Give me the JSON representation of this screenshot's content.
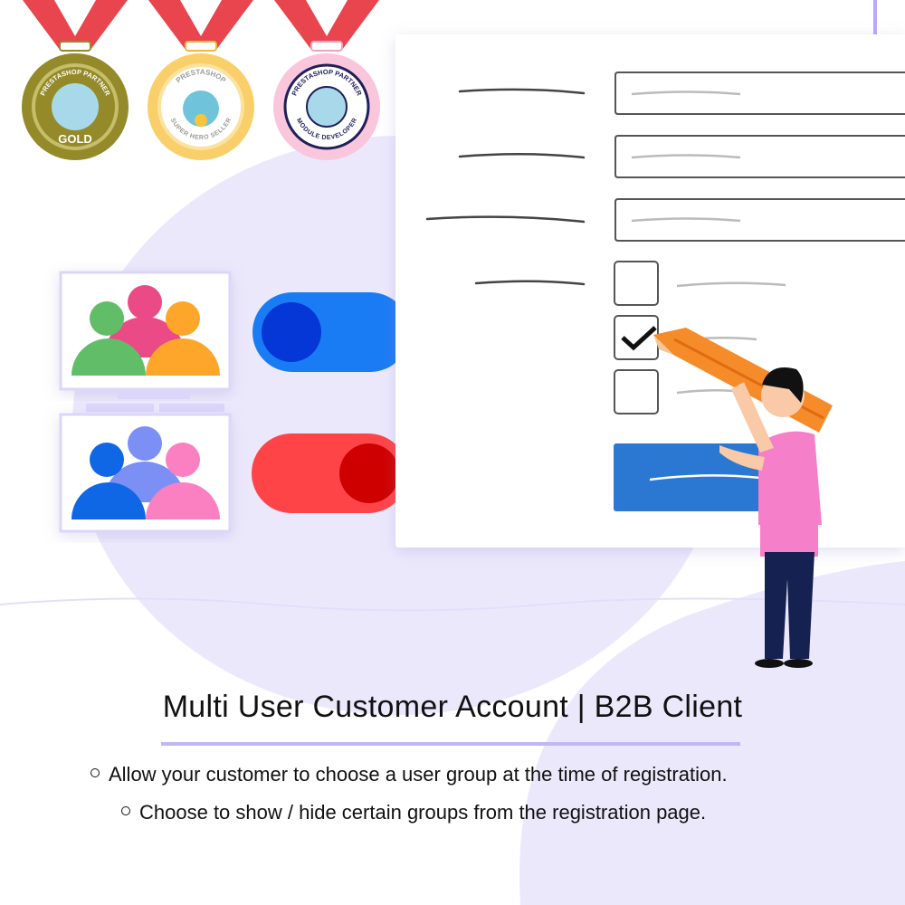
{
  "badges": [
    {
      "name": "gold",
      "text_top": "PRESTASHOP PARTNER",
      "text_bottom": "GOLD",
      "color": "#958a2a"
    },
    {
      "name": "super-hero-seller",
      "text_top": "PRESTASHOP",
      "text_bottom": "SUPER HERO SELLER",
      "color": "#f9cf6a"
    },
    {
      "name": "module-developer",
      "text_top": "PRESTASHOP PARTNER",
      "text_bottom": "MODULE DEVELOPER",
      "color": "#fac6dc"
    }
  ],
  "colors": {
    "background_blob": "#ece8fc",
    "ribbon": "#e8454f",
    "toggle_on": "#1a7cf5",
    "toggle_off": "#ff4448",
    "submit_button": "#2a78d2",
    "accent_rule": "#c3b6f6"
  },
  "toggles": [
    {
      "group": "group-1",
      "state": "on"
    },
    {
      "group": "group-2",
      "state": "off"
    }
  ],
  "checkboxes": [
    {
      "checked": false
    },
    {
      "checked": true
    },
    {
      "checked": false
    }
  ],
  "heading": "Multi User Customer Account | B2B Client",
  "bullets": [
    "Allow your customer to choose a user group at the time of registration.",
    "Choose to show / hide certain groups from the registration page."
  ]
}
